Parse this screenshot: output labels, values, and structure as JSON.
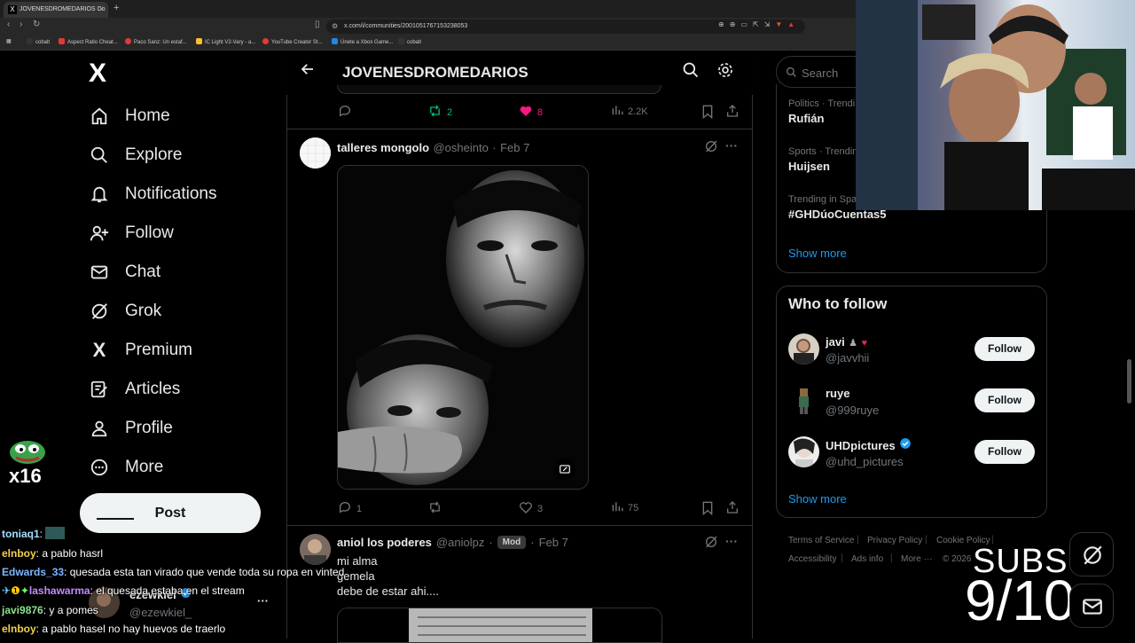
{
  "browser": {
    "tab_title": "JOVENESDROMEDARIOS Co",
    "url": "x.com/i/communities/2001051767153238053",
    "bookmarks": [
      "cobalt",
      "Aspect Ratio Cheat...",
      "Paco Sanz: Un estaf...",
      "IC Light V2-Vary - a...",
      "YouTube Creator St...",
      "Únete a Xbox Game...",
      "cobalt"
    ]
  },
  "nav": {
    "logo": "X",
    "items": [
      {
        "label": "Home",
        "icon": "home-icon"
      },
      {
        "label": "Explore",
        "icon": "search-icon"
      },
      {
        "label": "Notifications",
        "icon": "bell-icon"
      },
      {
        "label": "Follow",
        "icon": "follow-icon"
      },
      {
        "label": "Chat",
        "icon": "mail-icon"
      },
      {
        "label": "Grok",
        "icon": "grok-icon"
      },
      {
        "label": "Premium",
        "icon": "x-logo-icon"
      },
      {
        "label": "Articles",
        "icon": "articles-icon"
      },
      {
        "label": "Profile",
        "icon": "profile-icon"
      },
      {
        "label": "More",
        "icon": "more-circle-icon"
      }
    ],
    "post_label": "Post"
  },
  "community": {
    "title": "JOVENESDROMEDARIOS"
  },
  "prev_post_actions": {
    "retweets": "2",
    "likes": "8",
    "views": "2.2K"
  },
  "tweets": [
    {
      "name": "talleres mongolo",
      "handle": "@osheinto",
      "date": "Feb 7",
      "replies": "1",
      "likes": "3",
      "views": "75"
    },
    {
      "name": "aniol los poderes",
      "handle": "@aniolpz",
      "badge": "Mod",
      "date": "Feb 7",
      "lines": [
        "mi alma",
        "gemela",
        "debe de estar ahi...."
      ]
    }
  ],
  "sidebar": {
    "search_placeholder": "Search",
    "trends": [
      {
        "meta": "Politics · Trendi",
        "name": "Rufián"
      },
      {
        "meta": "Sports · Trendin",
        "name": "Huijsen"
      },
      {
        "meta": "Trending in Spa",
        "name": "#GHDúoCuentas5"
      }
    ],
    "show_more": "Show more",
    "who_to_follow_title": "Who to follow",
    "suggestions": [
      {
        "name": "javi",
        "handle": "@javvhii",
        "verified": false
      },
      {
        "name": "ruye",
        "handle": "@999ruye",
        "verified": false
      },
      {
        "name": "UHDpictures",
        "handle": "@uhd_pictures",
        "verified": true
      }
    ],
    "follow_label": "Follow",
    "show_more_2": "Show more",
    "footer": [
      "Terms of Service",
      "Privacy Policy",
      "Cookie Policy",
      "Accessibility",
      "Ads info",
      "More ···",
      "© 2026"
    ]
  },
  "overlay": {
    "subs_label": "SUBS",
    "subs_count": "9/10",
    "emote_count": "x16",
    "account_name": "ezewkiel",
    "account_handle": "@ezewkiel_",
    "chat": [
      {
        "user": "toniaq1",
        "msg": "",
        "color": "#a0e0ff"
      },
      {
        "user": "elnboy",
        "msg": "a pablo hasrl",
        "color": "#f2d24a"
      },
      {
        "user": "Edwards_33",
        "msg": "quesada esta tan virado que vende toda su ropa en vinted",
        "color": "#7fb6ff"
      },
      {
        "user": "lashawarma",
        "msg": "el quesada estaba en el stream",
        "color": "#c58bff"
      },
      {
        "user": "javi9876",
        "msg": "y a pomes",
        "color": "#8fe08f"
      },
      {
        "user": "elnboy",
        "msg": "a pablo hasel no hay huevos de traerlo",
        "color": "#f2d24a"
      }
    ]
  }
}
